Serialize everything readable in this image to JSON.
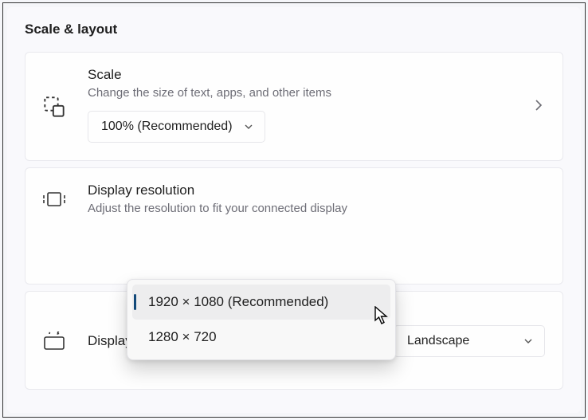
{
  "section": {
    "title": "Scale & layout"
  },
  "scale": {
    "title": "Scale",
    "desc": "Change the size of text, apps, and other items",
    "value": "100% (Recommended)"
  },
  "resolution": {
    "title": "Display resolution",
    "desc": "Adjust the resolution to fit your connected display",
    "options": [
      "1920 × 1080 (Recommended)",
      "1280 × 720"
    ]
  },
  "orientation": {
    "title": "Display orientation",
    "value": "Landscape"
  }
}
